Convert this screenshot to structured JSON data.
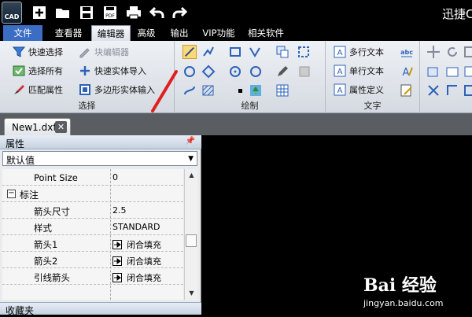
{
  "app": {
    "icon_label": "CAD",
    "title": "迅捷CAD"
  },
  "menus": [
    {
      "label": "文件"
    },
    {
      "label": "查看器"
    },
    {
      "label": "编辑器"
    },
    {
      "label": "高级"
    },
    {
      "label": "输出"
    },
    {
      "label": "VIP功能"
    },
    {
      "label": "相关软件"
    }
  ],
  "ribbon": {
    "select_group": {
      "label": "选择",
      "quick_select": "快速选择",
      "block_editor": "块编辑器",
      "select_all": "选择所有",
      "quick_entity_import": "快速实体导入",
      "match_properties": "匹配属性",
      "polygon_entity_input": "多边形实体输入"
    },
    "draw_group": {
      "label": "绘制"
    },
    "text_group": {
      "label": "文字",
      "mtext": "多行文本",
      "single_text": "单行文本",
      "attdef": "属性定义"
    }
  },
  "document_tab": {
    "label": "New1.dxf"
  },
  "properties": {
    "title": "属性",
    "selector_value": "默认值",
    "rows": [
      {
        "name": "Point Size",
        "value": "0"
      },
      {
        "section": "标注"
      },
      {
        "name": "箭头尺寸",
        "value": "2.5"
      },
      {
        "name": "样式",
        "value": "STANDARD"
      },
      {
        "name": "箭头1",
        "value": "闭合填充"
      },
      {
        "name": "箭头2",
        "value": "闭合填充"
      },
      {
        "name": "引线箭头",
        "value": "闭合填充"
      }
    ]
  },
  "favorites": {
    "title": "收藏夹"
  },
  "watermark": {
    "brand": "Bai 经验",
    "url": "jingyan.baidu.com"
  },
  "colors": {
    "accent_blue": "#3c6dc4",
    "ribbon_bg": "#e4e8ee",
    "annotation_red": "#e02020"
  }
}
